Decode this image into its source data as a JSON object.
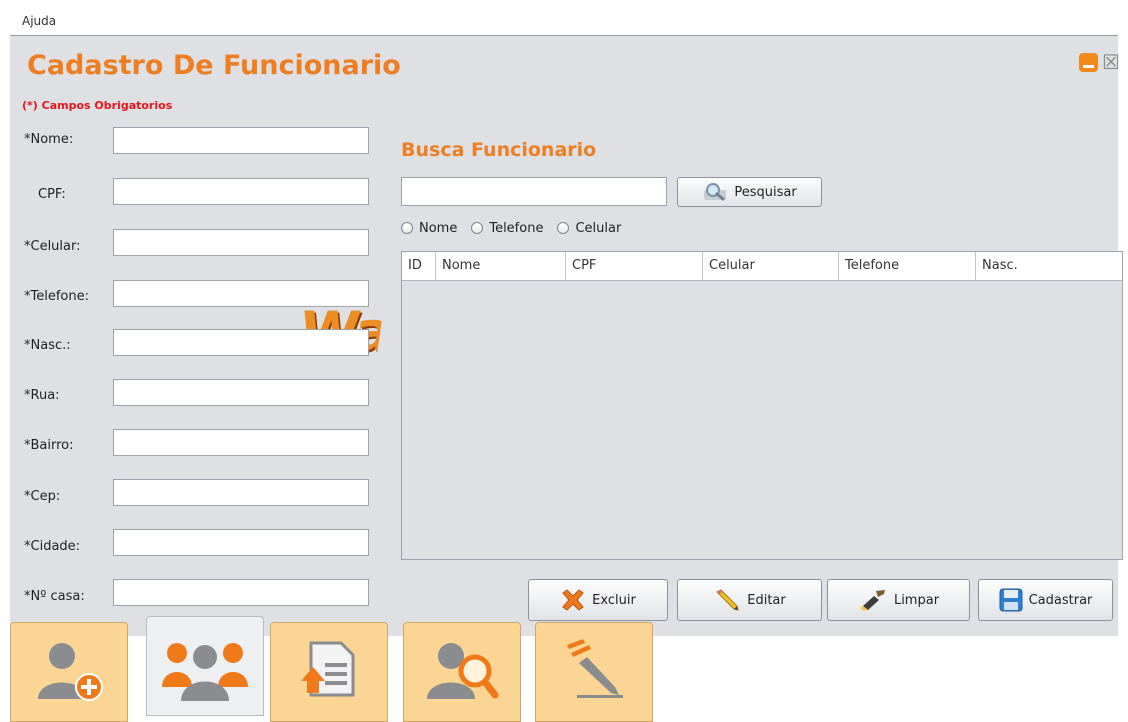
{
  "menu": {
    "help": "Ajuda"
  },
  "window": {
    "close_glyph": "☒"
  },
  "form": {
    "title": "Cadastro De Funcionario",
    "required_note": "(*) Campos Obrigatorios",
    "fields": [
      {
        "label": "*Nome:",
        "value": ""
      },
      {
        "label": "CPF:",
        "value": ""
      },
      {
        "label": "*Celular:",
        "value": ""
      },
      {
        "label": "*Telefone:",
        "value": ""
      },
      {
        "label": "*Nasc.:",
        "value": ""
      },
      {
        "label": "*Rua:",
        "value": ""
      },
      {
        "label": "*Bairro:",
        "value": ""
      },
      {
        "label": "*Cep:",
        "value": ""
      },
      {
        "label": "*Cidade:",
        "value": ""
      },
      {
        "label": "*Nº casa:",
        "value": ""
      }
    ]
  },
  "watermark": {
    "text": "Wald"
  },
  "search": {
    "title": "Busca Funcionario",
    "value": "",
    "button_label": "Pesquisar",
    "radios": [
      "Nome",
      "Telefone",
      "Celular"
    ]
  },
  "table": {
    "columns": [
      "ID",
      "Nome",
      "CPF",
      "Celular",
      "Telefone",
      "Nasc."
    ],
    "rows": []
  },
  "actions": {
    "delete_label": "Excluir",
    "edit_label": "Editar",
    "clear_label": "Limpar",
    "register_label": "Cadastrar"
  },
  "toolbar": {
    "icons": [
      "add-user-icon",
      "users-group-icon",
      "document-upload-icon",
      "user-search-icon",
      "edit-pencil-icon"
    ],
    "active_index": 1
  },
  "colors": {
    "accent": "#ee7e22",
    "required": "#e8131b",
    "panel": "#dfe0e4",
    "tool_button": "#fbd594"
  }
}
